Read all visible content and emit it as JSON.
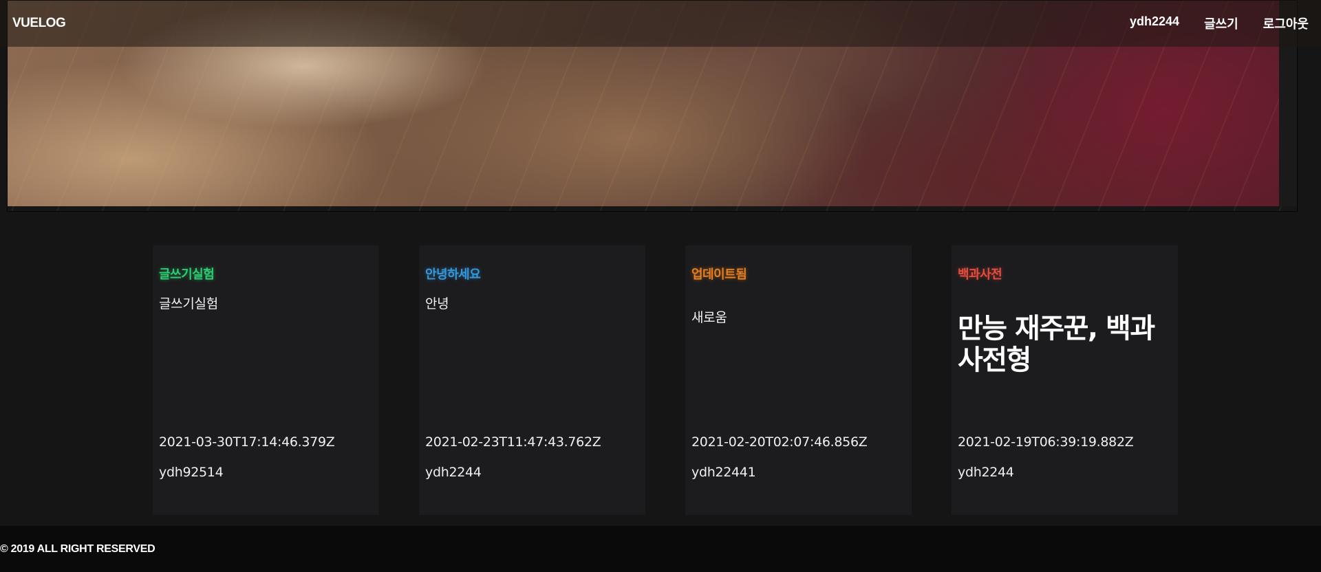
{
  "header": {
    "logo": "VUELOG",
    "nav": [
      {
        "label": "ydh2244"
      },
      {
        "label": "글쓰기"
      },
      {
        "label": "로그아웃"
      }
    ]
  },
  "posts": [
    {
      "title": "글쓰기실험",
      "title_color": "#2ecc71",
      "body": "글쓰기실험",
      "date": "2021-03-30T17:14:46.379Z",
      "author": "ydh92514"
    },
    {
      "title": "안녕하세요",
      "title_color": "#3498db",
      "body": "안녕",
      "date": "2021-02-23T11:47:43.762Z",
      "author": "ydh2244"
    },
    {
      "title": "업데이트됨",
      "title_color": "#e67e22",
      "body": "새로움",
      "date": "2021-02-20T02:07:46.856Z",
      "author": "ydh22441"
    },
    {
      "title": "백과사전",
      "title_color": "#e74c3c",
      "body": "만능 재주꾼, 백과사전형",
      "date": "2021-02-19T06:39:19.882Z",
      "author": "ydh2244"
    }
  ],
  "footer": {
    "text": "© 2019 ALL RIGHT RESERVED"
  }
}
